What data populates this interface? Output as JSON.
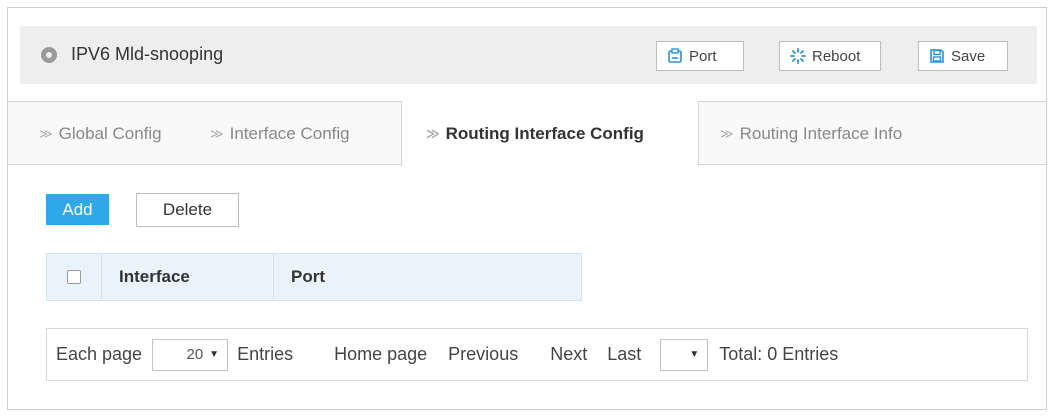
{
  "header": {
    "title": "IPV6 Mld-snooping",
    "buttons": {
      "port": "Port",
      "reboot": "Reboot",
      "save": "Save"
    }
  },
  "tabs": [
    {
      "label": "Global Config",
      "active": false
    },
    {
      "label": "Interface Config",
      "active": false
    },
    {
      "label": "Routing Interface Config",
      "active": true
    },
    {
      "label": "Routing Interface Info",
      "active": false
    }
  ],
  "actions": {
    "add": "Add",
    "delete": "Delete"
  },
  "table": {
    "columns": [
      "Interface",
      "Port"
    ],
    "rows": []
  },
  "pagination": {
    "each_page_label": "Each page",
    "page_size": "20",
    "entries_label": "Entries",
    "home": "Home page",
    "previous": "Previous",
    "next": "Next",
    "last": "Last",
    "page_select_value": "",
    "total": "Total: 0 Entries"
  },
  "colors": {
    "accent": "#2ea8e6",
    "icon_blue": "#2a93d5",
    "header_bg": "#eeeeee",
    "table_header_bg": "#eaf3fb"
  },
  "icons": {
    "title": "location-pin-icon",
    "port": "port-icon",
    "reboot": "reboot-icon",
    "save": "save-icon",
    "tab_chevron": "chevron-right-icon"
  }
}
